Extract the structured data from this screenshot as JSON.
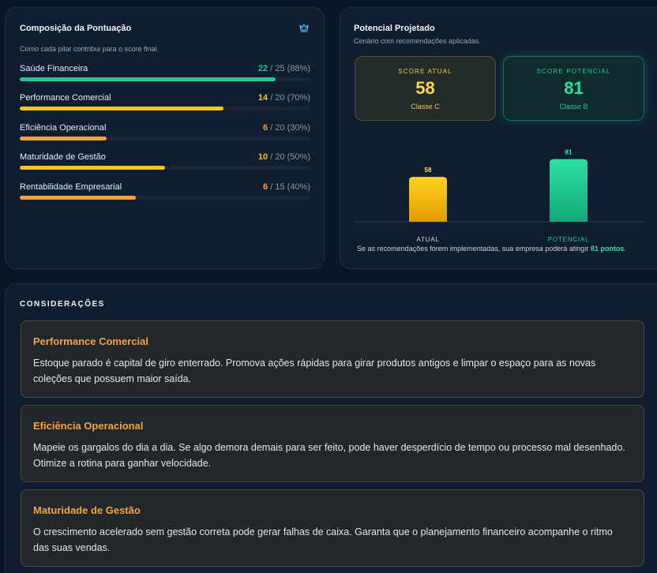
{
  "composition": {
    "title": "Composição da Pontuação",
    "subtitle": "Como cada pilar contribui para o score final.",
    "icon": "crown-icon",
    "pillars": [
      {
        "name": "Saúde Financeira",
        "points": "22",
        "max": "25",
        "pct": "(88%)",
        "fraction": 0.88,
        "color": "#22c993"
      },
      {
        "name": "Performance Comercial",
        "points": "14",
        "max": "20",
        "pct": "(70%)",
        "fraction": 0.7,
        "color": "#f5c518"
      },
      {
        "name": "Eficiência Operacional",
        "points": "6",
        "max": "20",
        "pct": "(30%)",
        "fraction": 0.3,
        "color": "#f5a340"
      },
      {
        "name": "Maturidade de Gestão",
        "points": "10",
        "max": "20",
        "pct": "(50%)",
        "fraction": 0.5,
        "color": "#f5c518"
      },
      {
        "name": "Rentabilidade Empresarial",
        "points": "6",
        "max": "15",
        "pct": "(40%)",
        "fraction": 0.4,
        "color": "#f5a340"
      }
    ]
  },
  "projection": {
    "title": "Potencial Projetado",
    "subtitle": "Cenário com recomendações aplicadas.",
    "current": {
      "label": "SCORE ATUAL",
      "value": "58",
      "class": "Classe C"
    },
    "potential": {
      "label": "SCORE POTENCIAL",
      "value": "81",
      "class": "Classe B"
    },
    "note_prefix": "Se as recomendações forem implementadas, sua empresa poderá atingir ",
    "note_highlight": "81 pontos",
    "note_suffix": "."
  },
  "chart_data": {
    "type": "bar",
    "categories": [
      "ATUAL",
      "POTENCIAL"
    ],
    "values": [
      58,
      81
    ],
    "colors": [
      "#f5c518",
      "#22c993"
    ]
  },
  "considerations": {
    "heading": "CONSIDERAÇÕES",
    "items": [
      {
        "title": "Performance Comercial",
        "text": "Estoque parado é capital de giro enterrado. Promova ações rápidas para girar produtos antigos e limpar o espaço para as novas coleções que possuem maior saída."
      },
      {
        "title": "Eficiência Operacional",
        "text": "Mapeie os gargalos do dia a dia. Se algo demora demais para ser feito, pode haver desperdício de tempo ou processo mal desenhado. Otimize a rotina para ganhar velocidade."
      },
      {
        "title": "Maturidade de Gestão",
        "text": "O crescimento acelerado sem gestão correta pode gerar falhas de caixa. Garanta que o planejamento financeiro acompanhe o ritmo das suas vendas."
      }
    ]
  }
}
